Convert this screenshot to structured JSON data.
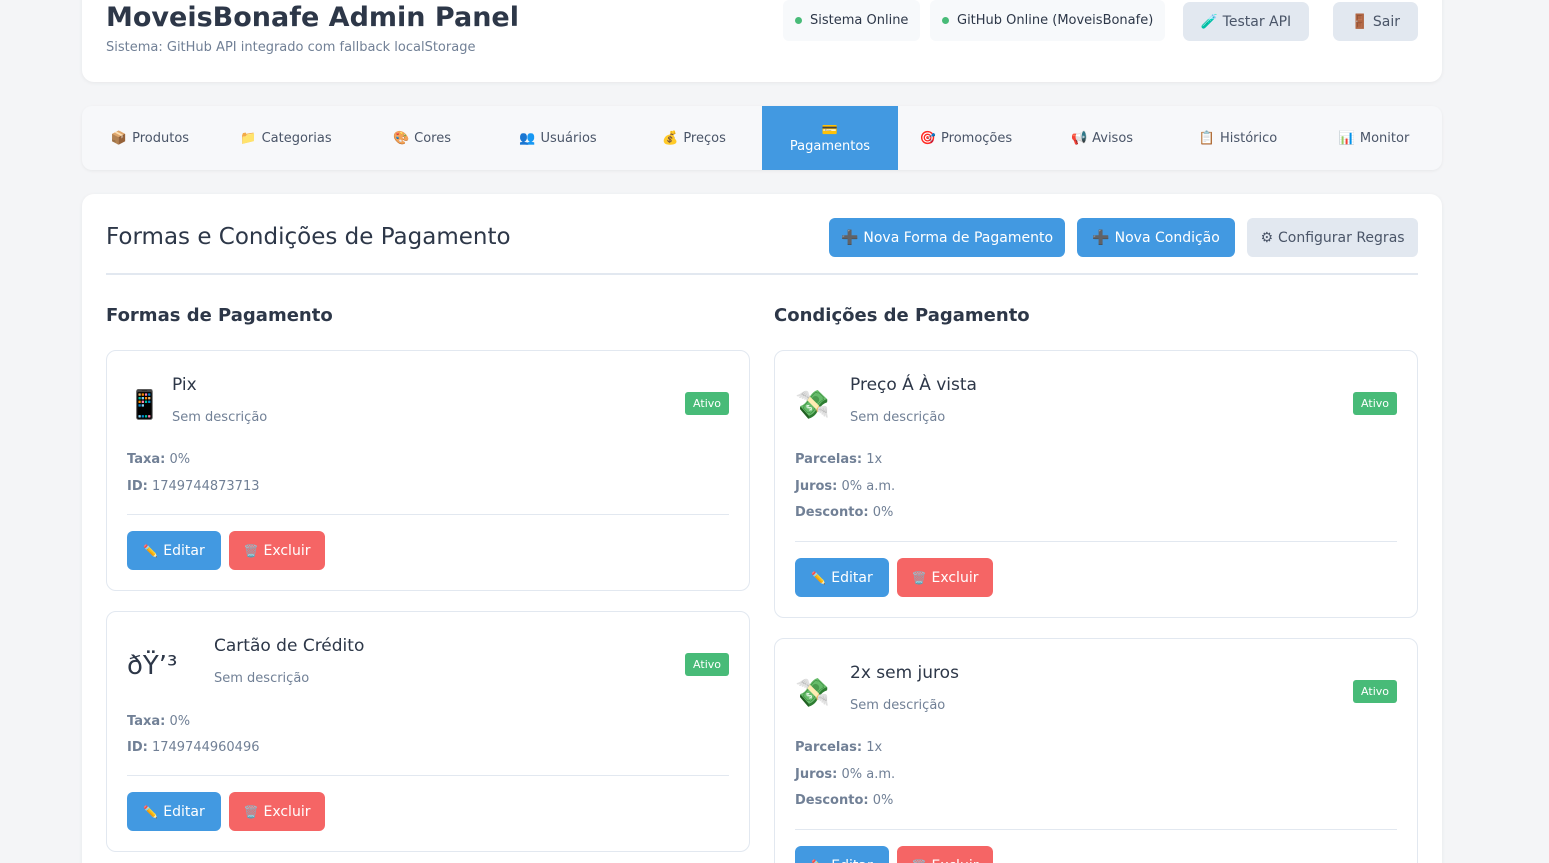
{
  "header": {
    "title": "MoveisBonafe Admin Panel",
    "subtitle": "Sistema: GitHub API integrado com fallback localStorage",
    "status_system": "Sistema Online",
    "status_github": "GitHub Online (MoveisBonafe)",
    "test_api": "🧪 Testar API",
    "logout": "🚪 Sair"
  },
  "tabs": [
    {
      "icon": "📦",
      "label": "Produtos"
    },
    {
      "icon": "📁",
      "label": "Categorias"
    },
    {
      "icon": "🎨",
      "label": "Cores"
    },
    {
      "icon": "👥",
      "label": "Usuários"
    },
    {
      "icon": "💰",
      "label": "Preços"
    },
    {
      "icon": "💳",
      "label": "Pagamentos"
    },
    {
      "icon": "🎯",
      "label": "Promoções"
    },
    {
      "icon": "📢",
      "label": "Avisos"
    },
    {
      "icon": "📋",
      "label": "Histórico"
    },
    {
      "icon": "📊",
      "label": "Monitor"
    }
  ],
  "main": {
    "title": "Formas e Condições de Pagamento",
    "new_method": "Nova Forma de Pagamento",
    "new_condition": "Nova Condição",
    "configure_rules": "Configurar Regras",
    "plus_icon": "➕",
    "gear_icon": "⚙"
  },
  "methods_heading": "Formas de Pagamento",
  "conditions_heading": "Condições de Pagamento",
  "labels": {
    "taxa": "Taxa:",
    "id": "ID:",
    "parcelas": "Parcelas:",
    "juros": "Juros:",
    "desconto": "Desconto:",
    "edit": "Editar",
    "delete": "Excluir",
    "edit_icon": "✏️",
    "delete_icon": "🗑️"
  },
  "methods": [
    {
      "icon": "📱",
      "name": "Pix",
      "description": "Sem descrição",
      "badge": "Ativo",
      "taxa": "0%",
      "id": "1749744873713"
    },
    {
      "icon": "ðŸ’³",
      "name": "Cartão de Crédito",
      "description": "Sem descrição",
      "badge": "Ativo",
      "taxa": "0%",
      "id": "1749744960496"
    }
  ],
  "conditions": [
    {
      "icon": "💸",
      "name": "Preço Á À vista",
      "description": "Sem descrição",
      "badge": "Ativo",
      "parcelas": "1x",
      "juros": "0% a.m.",
      "desconto": "0%"
    },
    {
      "icon": "💸",
      "name": "2x sem juros",
      "description": "Sem descrição",
      "badge": "Ativo",
      "parcelas": "1x",
      "juros": "0% a.m.",
      "desconto": "0%"
    }
  ]
}
